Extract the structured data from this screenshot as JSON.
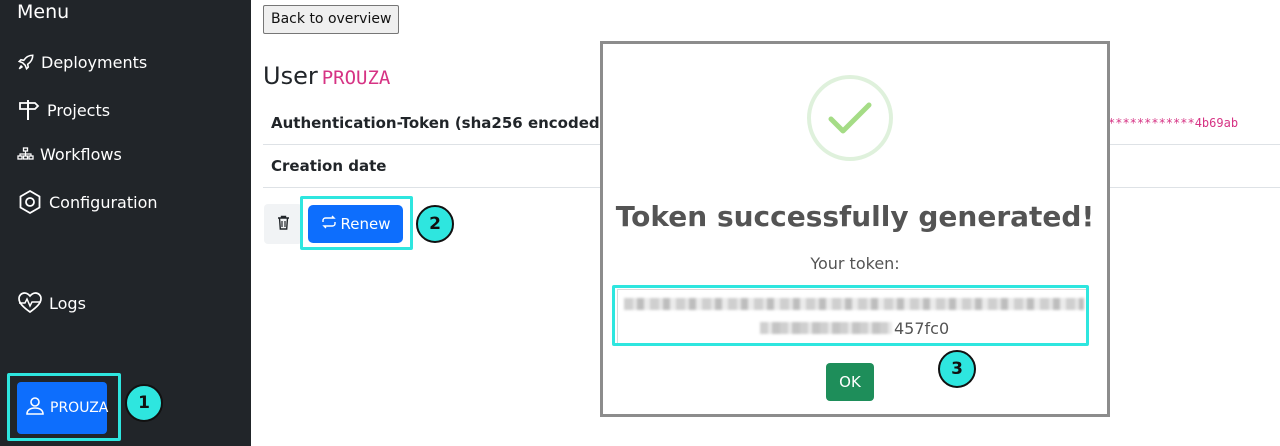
{
  "sidebar": {
    "title": "Menu",
    "items": [
      {
        "label": "Deployments",
        "icon": "rocket-icon"
      },
      {
        "label": "Projects",
        "icon": "signpost-icon"
      },
      {
        "label": "Workflows",
        "icon": "diagram-icon"
      },
      {
        "label": "Configuration",
        "icon": "hexagon-icon"
      },
      {
        "label": "Logs",
        "icon": "heart-pulse-icon"
      }
    ],
    "user": {
      "label": "PROUZA",
      "icon": "person-icon"
    }
  },
  "main": {
    "back_label": "Back to overview",
    "heading_prefix": "User",
    "username": "PROUZA",
    "rows": [
      {
        "label": "Authentication-Token (sha256 encoded)",
        "value": "************4b69ab"
      },
      {
        "label": "Creation date",
        "value": ""
      }
    ],
    "renew_label": "Renew",
    "delete_icon": "trash-icon"
  },
  "modal": {
    "title": "Token successfully generated!",
    "token_label": "Your token:",
    "token_visible_suffix": "457fc0",
    "ok_label": "OK"
  },
  "callouts": [
    "1",
    "2",
    "3"
  ],
  "colors": {
    "accent": "#0d6efd",
    "highlight": "#2ee6df",
    "success": "#1e8e5a",
    "token": "#d63384"
  }
}
